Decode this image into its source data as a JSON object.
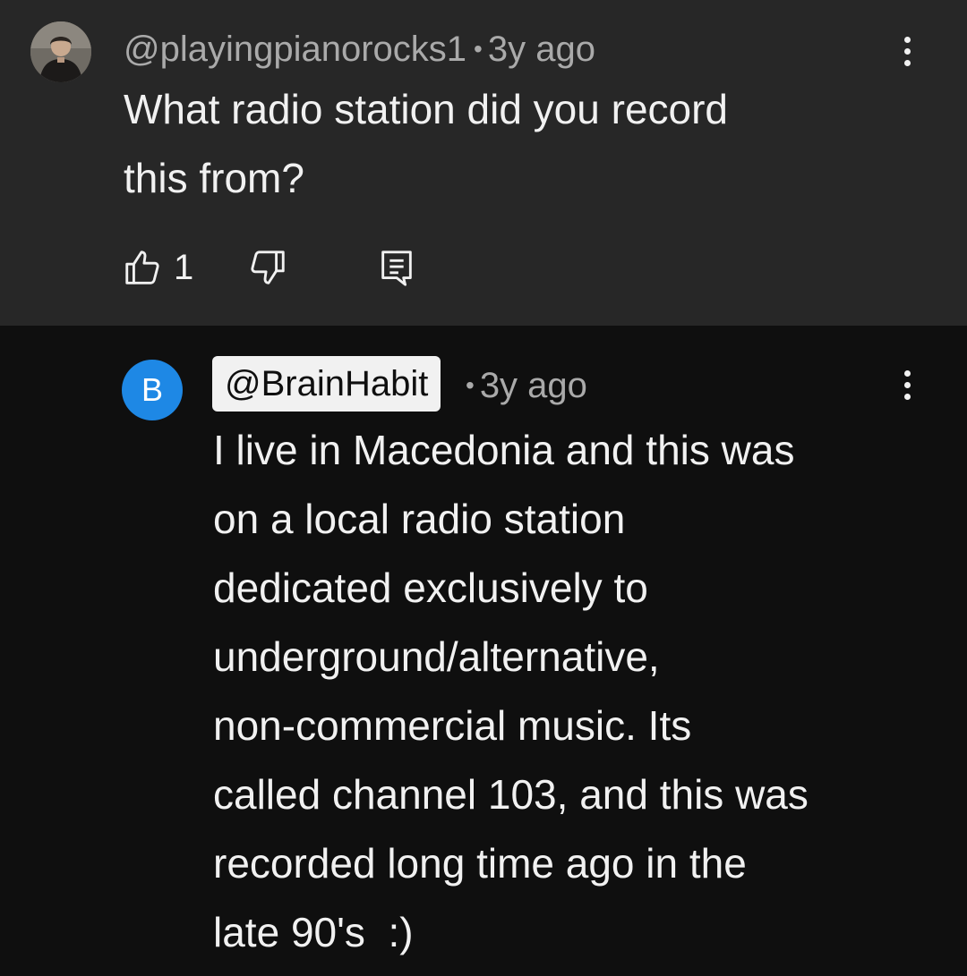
{
  "comment": {
    "handle": "@playingpianorocks1",
    "separator": "•",
    "time": "3y ago",
    "text_lines": [
      "What radio station did you record",
      "this from?"
    ],
    "likes": "1"
  },
  "reply": {
    "avatar_letter": "B",
    "handle": "@BrainHabit",
    "separator": "•",
    "time": "3y ago",
    "text_lines": [
      "I live in Macedonia and this was",
      "on a local radio station",
      "dedicated exclusively to",
      "underground/alternative,",
      "non-commercial music. Its",
      "called channel 103, and this was",
      "recorded long time ago in the",
      "late 90's  :)"
    ]
  },
  "colors": {
    "top_background": "#272727",
    "page_background": "#0f0f0f",
    "meta_text": "#aaaaaa",
    "avatar_blue": "#1e88e5"
  },
  "icons": [
    "user-photo-avatar",
    "more-vert-icon",
    "thumb-up-icon",
    "thumb-down-icon",
    "reply-comment-icon"
  ]
}
